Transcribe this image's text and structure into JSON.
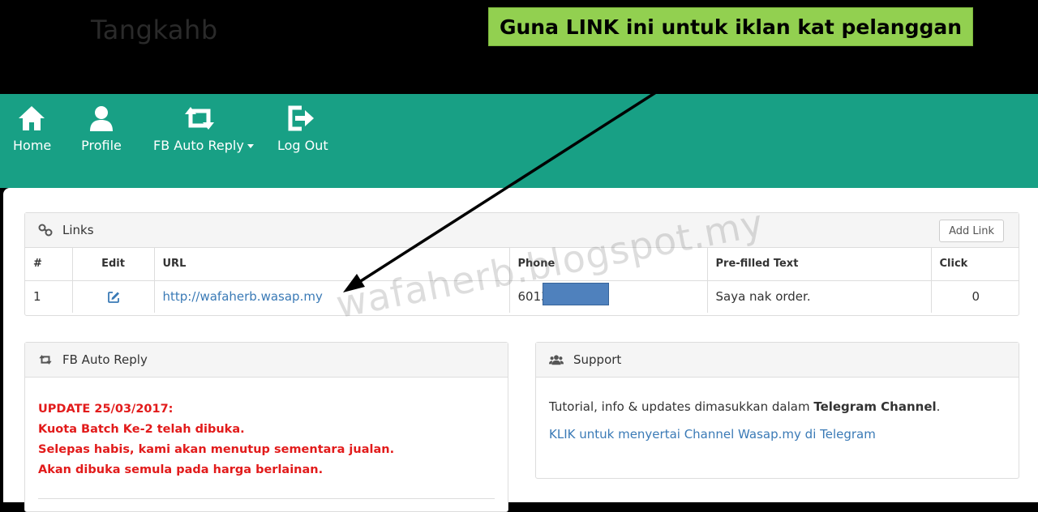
{
  "header": {
    "logo_text": "Tangkahb",
    "callout": "Guna LINK ini untuk iklan kat pelanggan"
  },
  "nav": {
    "home": "Home",
    "profile": "Profile",
    "fb_auto_reply": "FB Auto Reply",
    "logout": "Log Out"
  },
  "links_panel": {
    "title": "Links",
    "add_button": "Add Link",
    "columns": [
      "#",
      "Edit",
      "URL",
      "Phone",
      "Pre-filled Text",
      "Click"
    ],
    "rows": [
      {
        "num": "1",
        "url": "http://wafaherb.wasap.my",
        "phone": "6013",
        "prefilled": "Saya nak order.",
        "clicks": "0"
      }
    ]
  },
  "fb_panel": {
    "title": "FB Auto Reply",
    "lines": [
      "UPDATE 25/03/2017:",
      "Kuota Batch Ke-2 telah dibuka.",
      "Selepas habis, kami akan menutup sementara jualan.",
      "Akan dibuka semula pada harga berlainan."
    ]
  },
  "support_panel": {
    "title": "Support",
    "text_before": "Tutorial, info & updates dimasukkan dalam ",
    "text_bold": "Telegram Channel",
    "text_after": ".",
    "link": "KLIK untuk menyertai Channel Wasap.my di Telegram"
  },
  "watermark": "wafaherb.blogspot.my",
  "colors": {
    "navbar": "#18a085",
    "callout": "#92d050",
    "alert": "#e21b1b",
    "link": "#3a7ab6",
    "redaction": "#4f81bd"
  },
  "icons": {
    "home": "home-icon",
    "profile": "user-icon",
    "fb_auto_reply": "retweet-icon",
    "logout": "logout-icon",
    "links": "link-icon",
    "edit": "edit-icon",
    "support": "users-icon"
  }
}
